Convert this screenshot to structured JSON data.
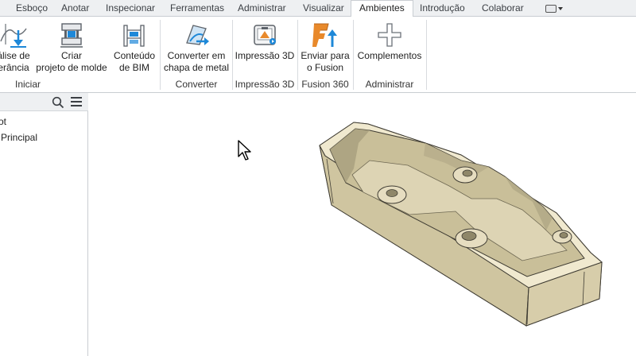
{
  "tabs": [
    {
      "label": "Esboço"
    },
    {
      "label": "Anotar"
    },
    {
      "label": "Inspecionar"
    },
    {
      "label": "Ferramentas"
    },
    {
      "label": "Administrar"
    },
    {
      "label": "Visualizar"
    },
    {
      "label": "Ambientes",
      "active": true
    },
    {
      "label": "Introdução"
    },
    {
      "label": "Colaborar"
    }
  ],
  "ribbon": {
    "buttons": {
      "analise": "álise de\nerância",
      "criar_molde": "Criar\nprojeto de molde",
      "conteudo_bim": "Conteúdo\nde BIM",
      "converter_chapa": "Converter em\nchapa de metal",
      "impressao_3d": "Impressão 3D",
      "enviar_fusion": "Enviar para\no Fusion",
      "complementos": "Complementos"
    },
    "panels": {
      "iniciar": "Iniciar",
      "converter": "Converter",
      "impressao_3d": "Impressão 3D",
      "fusion_360": "Fusion 360",
      "administrar": "Administrar"
    },
    "accent_blue": "#1e88d8",
    "fusion_orange": "#e8892b"
  },
  "browser": {
    "items": [
      "ot",
      "Principal"
    ]
  },
  "viewport": {
    "model_color": "#ede5c9"
  }
}
